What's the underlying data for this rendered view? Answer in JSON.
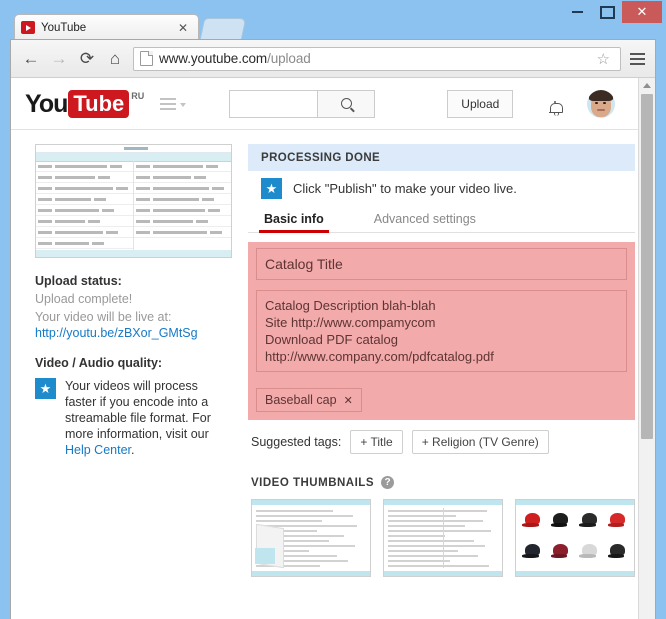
{
  "window": {
    "minimize_label": "minimize",
    "maximize_label": "maximize",
    "close_label": "✕"
  },
  "browser": {
    "tab": {
      "title": "YouTube",
      "close_label": "✕",
      "favicon": "youtube-play-icon"
    },
    "nav": {
      "back": "←",
      "forward": "→",
      "reload": "⟳",
      "home": "⌂",
      "bookmark_star": "☆"
    },
    "url": {
      "domain": "www.youtube.com",
      "path": "/upload"
    }
  },
  "masthead": {
    "logo": {
      "you": "You",
      "tube": "Tube",
      "country": "RU"
    },
    "search": {
      "value": "",
      "placeholder": "",
      "button_label": "search-icon"
    },
    "upload_label": "Upload",
    "notifications_label": "notifications",
    "avatar_label": "account"
  },
  "left": {
    "preview_alt": "catalog spreadsheet preview",
    "upload_status_label": "Upload status:",
    "upload_status_value": "Upload complete!",
    "live_at_label": "Your video will be live at:",
    "live_at_url": "http://youtu.be/zBXor_GMtSg",
    "quality_label": "Video / Audio quality:",
    "quality_badge": "★",
    "quality_text": "Your videos will process faster if you encode into a streamable file format. For more information, visit our ",
    "quality_link": "Help Center",
    "quality_text_end": "."
  },
  "main": {
    "processing_status": "PROCESSING DONE",
    "publish_badge": "★",
    "publish_hint": "Click \"Publish\" to make your video live.",
    "tabs": [
      {
        "label": "Basic info",
        "active": true
      },
      {
        "label": "Advanced settings",
        "active": false
      }
    ],
    "form": {
      "title_value": "Catalog Title",
      "description_lines": [
        "Catalog Description blah-blah",
        "Site http://www.compamycom",
        "Download PDF catalog http://www.company.com/pdfcatalog.pdf"
      ],
      "tags": [
        {
          "label": "Baseball cap",
          "remove": "✕"
        }
      ]
    },
    "suggested": {
      "lead": "Suggested tags:",
      "buttons": [
        "+ Title",
        "+ Religion (TV Genre)"
      ]
    },
    "thumbnails": {
      "heading": "VIDEO THUMBNAILS",
      "help": "?",
      "items": [
        {
          "name": "thumbnail-catalog-spread",
          "kind": "sheet"
        },
        {
          "name": "thumbnail-catalog-table",
          "kind": "sheet"
        },
        {
          "name": "thumbnail-caps-grid",
          "kind": "caps"
        }
      ]
    }
  },
  "colors": {
    "youtube_red": "#cc181e",
    "form_pink": "#f2aaaa",
    "processing_blue": "#dceafa",
    "link_blue": "#167ac6",
    "badge_blue": "#1e8bcd",
    "window_blue": "#8cc2f0"
  }
}
